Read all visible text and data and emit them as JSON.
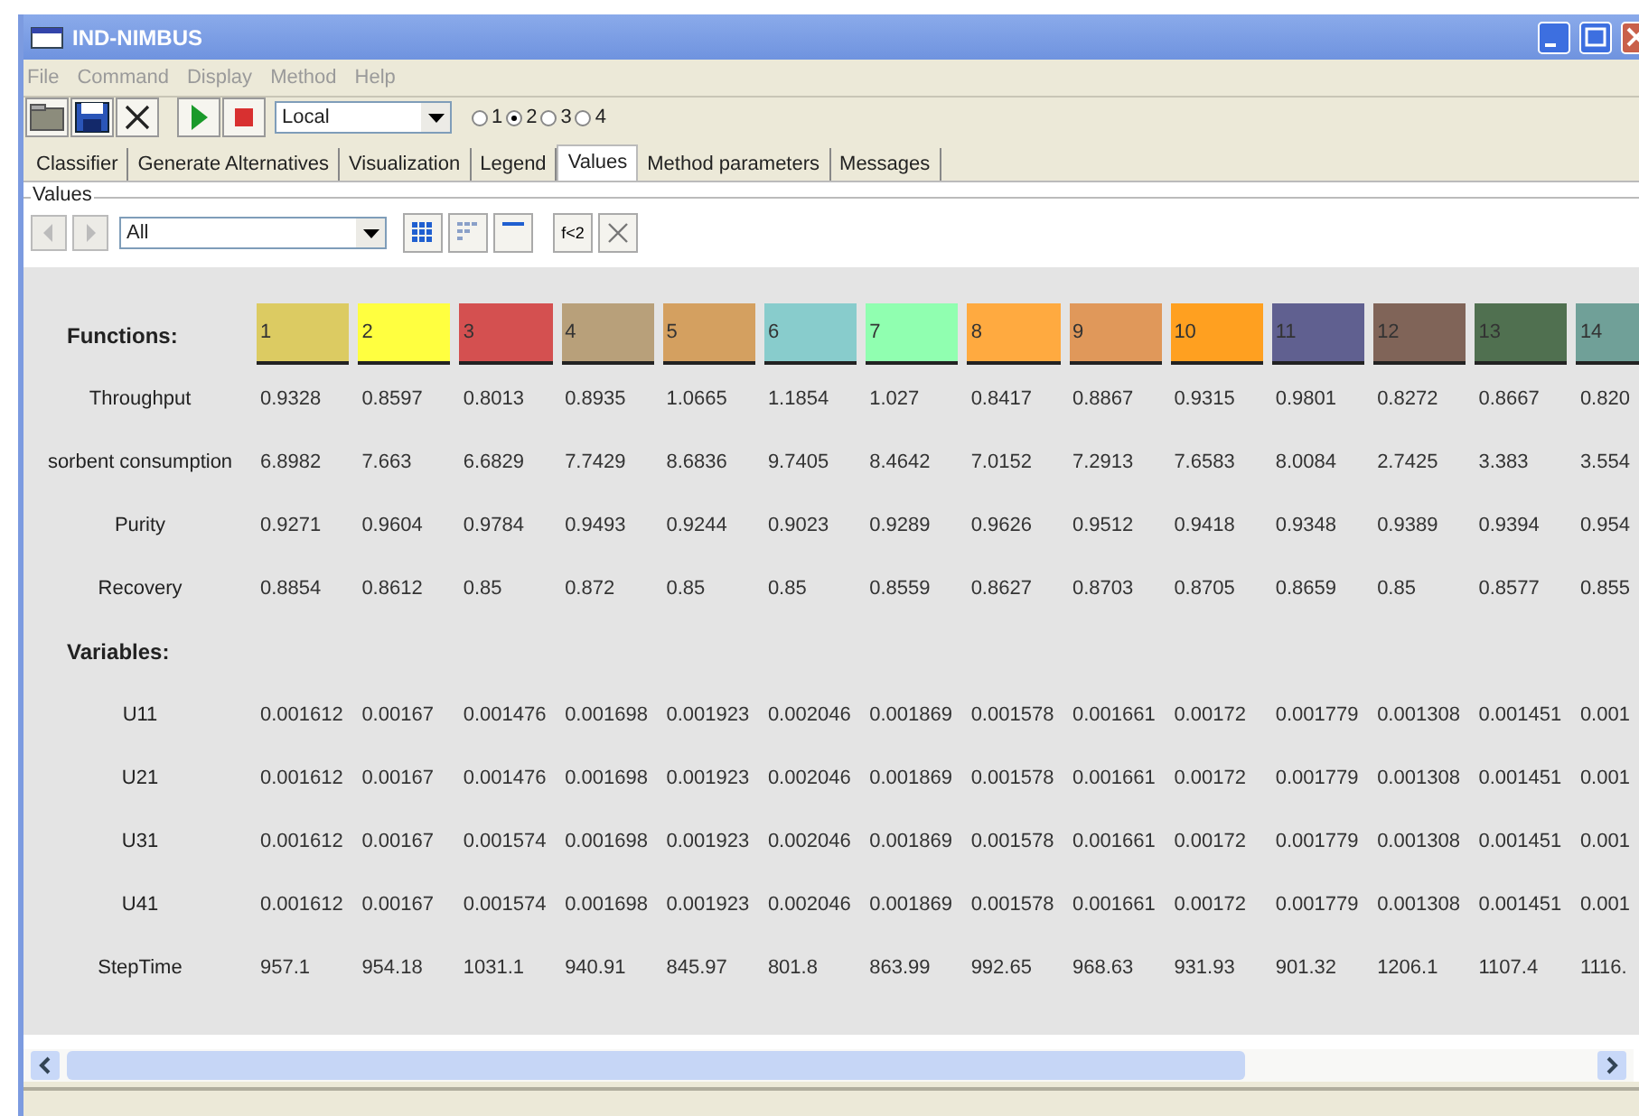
{
  "window": {
    "title": "IND-NIMBUS"
  },
  "menu": [
    "File",
    "Command",
    "Display",
    "Method",
    "Help"
  ],
  "toolbar": {
    "mode_combo": "Local",
    "radios": [
      {
        "label": "1",
        "selected": false
      },
      {
        "label": "2",
        "selected": true
      },
      {
        "label": "3",
        "selected": false
      },
      {
        "label": "4",
        "selected": false
      }
    ]
  },
  "tabs": [
    {
      "label": "Classifier",
      "selected": false
    },
    {
      "label": "Generate Alternatives",
      "selected": false
    },
    {
      "label": "Visualization",
      "selected": false
    },
    {
      "label": "Legend",
      "selected": false
    },
    {
      "label": "Values",
      "selected": true
    },
    {
      "label": "Method parameters",
      "selected": false
    },
    {
      "label": "Messages",
      "selected": false
    }
  ],
  "values_panel": {
    "group_label": "Values",
    "filter_combo": "All",
    "filter_button": "f<2",
    "table": {
      "heading": "Functions:",
      "columns": [
        {
          "label": "1",
          "color": "#dccb62"
        },
        {
          "label": "2",
          "color": "#ffff40"
        },
        {
          "label": "3",
          "color": "#d45050"
        },
        {
          "label": "4",
          "color": "#b8a07a"
        },
        {
          "label": "5",
          "color": "#d4a060"
        },
        {
          "label": "6",
          "color": "#88cccc"
        },
        {
          "label": "7",
          "color": "#90ffb0"
        },
        {
          "label": "8",
          "color": "#ffaa40"
        },
        {
          "label": "9",
          "color": "#e0985a"
        },
        {
          "label": "10",
          "color": "#ffa020"
        },
        {
          "label": "11",
          "color": "#606090"
        },
        {
          "label": "12",
          "color": "#806458"
        },
        {
          "label": "13",
          "color": "#507050"
        },
        {
          "label": "14",
          "color": "#70a098"
        }
      ],
      "rows": [
        {
          "kind": "value",
          "name": "Throughput",
          "values": [
            "0.9328",
            "0.8597",
            "0.8013",
            "0.8935",
            "1.0665",
            "1.1854",
            "1.027",
            "0.8417",
            "0.8867",
            "0.9315",
            "0.9801",
            "0.8272",
            "0.8667",
            "0.820"
          ]
        },
        {
          "kind": "value",
          "name": "sorbent consumption",
          "values": [
            "6.8982",
            "7.663",
            "6.6829",
            "7.7429",
            "8.6836",
            "9.7405",
            "8.4642",
            "7.0152",
            "7.2913",
            "7.6583",
            "8.0084",
            "2.7425",
            "3.383",
            "3.554"
          ]
        },
        {
          "kind": "value",
          "name": "Purity",
          "values": [
            "0.9271",
            "0.9604",
            "0.9784",
            "0.9493",
            "0.9244",
            "0.9023",
            "0.9289",
            "0.9626",
            "0.9512",
            "0.9418",
            "0.9348",
            "0.9389",
            "0.9394",
            "0.954"
          ]
        },
        {
          "kind": "value",
          "name": "Recovery",
          "values": [
            "0.8854",
            "0.8612",
            "0.85",
            "0.872",
            "0.85",
            "0.85",
            "0.8559",
            "0.8627",
            "0.8703",
            "0.8705",
            "0.8659",
            "0.85",
            "0.8577",
            "0.855"
          ]
        },
        {
          "kind": "heading",
          "name": "Variables:"
        },
        {
          "kind": "value",
          "name": "U11",
          "values": [
            "0.001612",
            "0.00167",
            "0.001476",
            "0.001698",
            "0.001923",
            "0.002046",
            "0.001869",
            "0.001578",
            "0.001661",
            "0.00172",
            "0.001779",
            "0.001308",
            "0.001451",
            "0.001"
          ]
        },
        {
          "kind": "value",
          "name": "U21",
          "values": [
            "0.001612",
            "0.00167",
            "0.001476",
            "0.001698",
            "0.001923",
            "0.002046",
            "0.001869",
            "0.001578",
            "0.001661",
            "0.00172",
            "0.001779",
            "0.001308",
            "0.001451",
            "0.001"
          ]
        },
        {
          "kind": "value",
          "name": "U31",
          "values": [
            "0.001612",
            "0.00167",
            "0.001574",
            "0.001698",
            "0.001923",
            "0.002046",
            "0.001869",
            "0.001578",
            "0.001661",
            "0.00172",
            "0.001779",
            "0.001308",
            "0.001451",
            "0.001"
          ]
        },
        {
          "kind": "value",
          "name": "U41",
          "values": [
            "0.001612",
            "0.00167",
            "0.001574",
            "0.001698",
            "0.001923",
            "0.002046",
            "0.001869",
            "0.001578",
            "0.001661",
            "0.00172",
            "0.001779",
            "0.001308",
            "0.001451",
            "0.001"
          ]
        },
        {
          "kind": "value",
          "name": "StepTime",
          "values": [
            "957.1",
            "954.18",
            "1031.1",
            "940.91",
            "845.97",
            "801.8",
            "863.99",
            "992.65",
            "968.63",
            "931.93",
            "901.32",
            "1206.1",
            "1107.4",
            "1116."
          ]
        }
      ]
    }
  }
}
